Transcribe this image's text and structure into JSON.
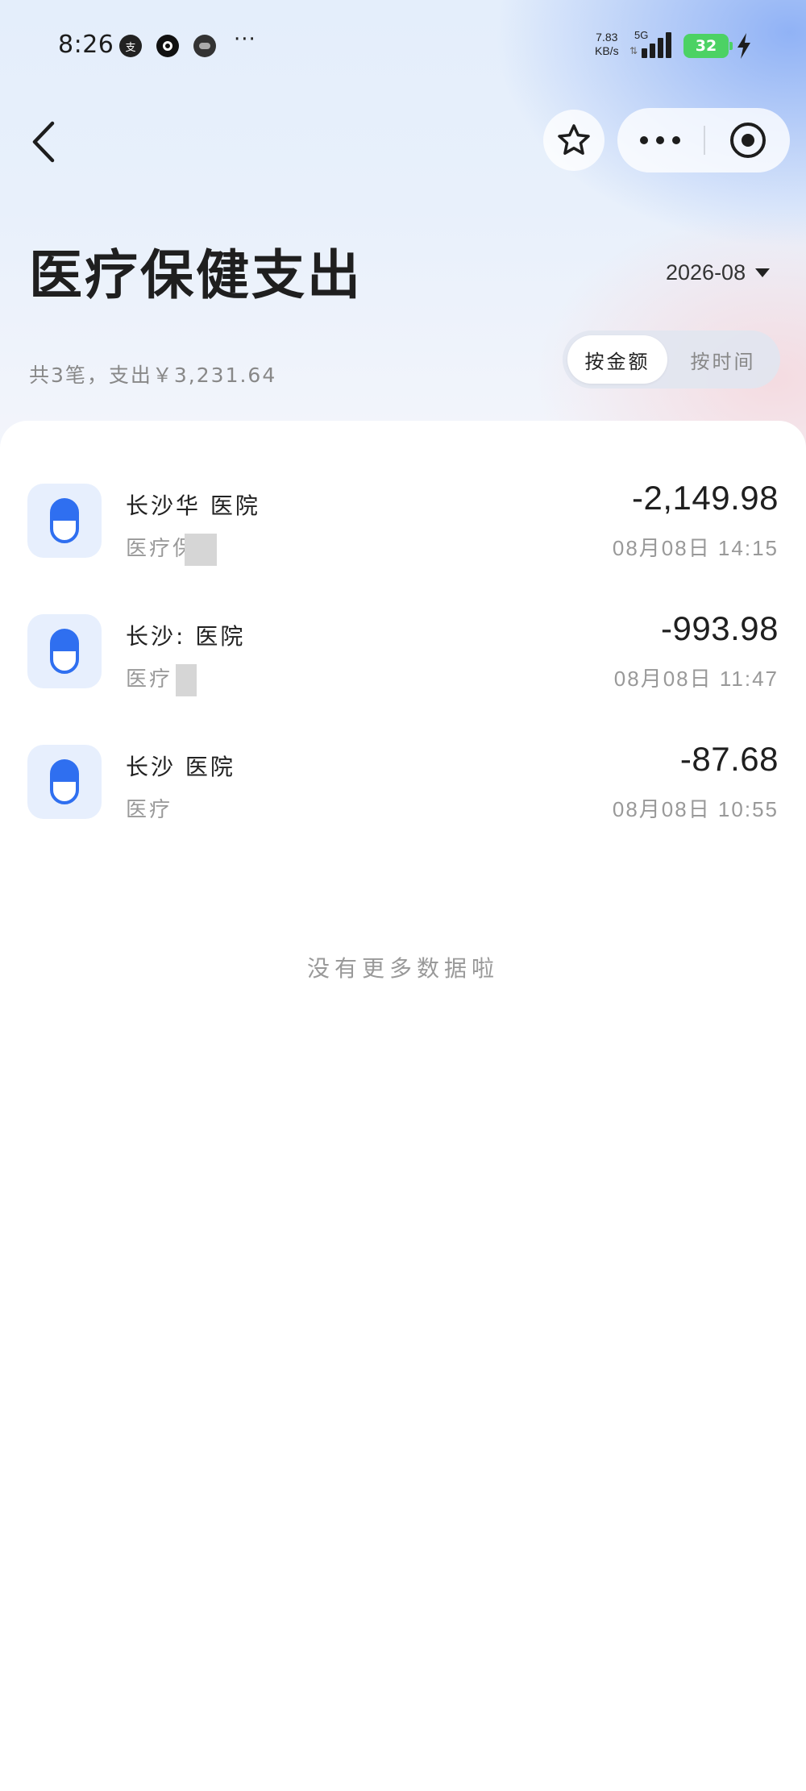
{
  "status_bar": {
    "time": "8:26",
    "apps": [
      "支",
      "●",
      "●"
    ],
    "more": "···",
    "net_speed": "7.83",
    "net_unit": "KB/s",
    "network": "5G",
    "battery": "32"
  },
  "header": {
    "title": "医疗保健支出",
    "month": "2026-08",
    "summary": "共3笔，支出￥3,231.64",
    "sort_tabs": [
      {
        "label": "按金额",
        "active": true
      },
      {
        "label": "按时间",
        "active": false
      }
    ]
  },
  "transactions": [
    {
      "merchant": "长沙华 医院",
      "category": "医疗保",
      "amount": "-2,149.98",
      "datetime": "08月08日  14:15"
    },
    {
      "merchant": "长沙: 医院",
      "category": "医疗",
      "amount": "-993.98",
      "datetime": "08月08日  11:47"
    },
    {
      "merchant": "长沙 医院",
      "category": "医疗",
      "amount": "-87.68",
      "datetime": "08月08日  10:55"
    }
  ],
  "footer": {
    "no_more": "没有更多数据啦"
  },
  "colors": {
    "icon_blue": "#2f6ff0",
    "icon_bg": "#e7effd",
    "battery_green": "#4cd264"
  }
}
